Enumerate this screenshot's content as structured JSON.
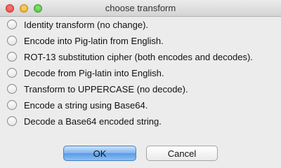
{
  "window": {
    "title": "choose transform"
  },
  "options": [
    {
      "label": "Identity transform (no change)."
    },
    {
      "label": "Encode into Pig-latin from English."
    },
    {
      "label": "ROT-13 substitution cipher (both encodes and decodes)."
    },
    {
      "label": "Decode from Pig-latin into English."
    },
    {
      "label": "Transform to UPPERCASE (no decode)."
    },
    {
      "label": "Encode a string using Base64."
    },
    {
      "label": "Decode a Base64 encoded string."
    }
  ],
  "buttons": {
    "ok_label": "OK",
    "cancel_label": "Cancel"
  },
  "colors": {
    "accent": "#5a9ae6",
    "window_bg": "#ececec"
  }
}
